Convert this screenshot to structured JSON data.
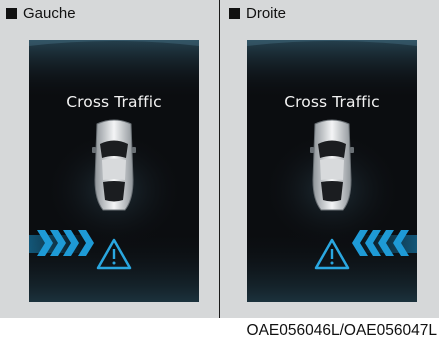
{
  "panels": [
    {
      "label": "Gauche",
      "screen_title": "Cross Traffic",
      "arrow_direction": "right"
    },
    {
      "label": "Droite",
      "screen_title": "Cross Traffic",
      "arrow_direction": "left"
    }
  ],
  "footer_code": "OAE056046L/OAE056047L",
  "colors": {
    "panel_background": "#d6d8d9",
    "screen_background": "#0b0d10",
    "arrow_blue": "#1e9ad6",
    "warning_blue": "#2aa7e0",
    "title_text": "#f2f2f2"
  },
  "icons": [
    "square-bullet-icon",
    "car-top-view-icon",
    "chevron-arrows-icon",
    "warning-triangle-icon"
  ]
}
